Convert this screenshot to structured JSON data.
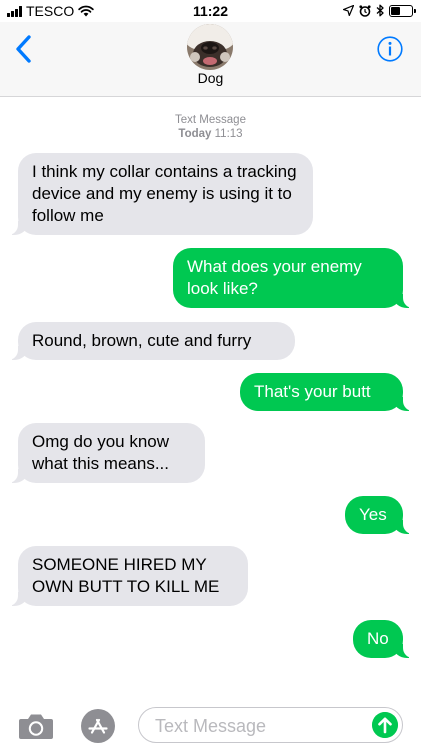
{
  "status_bar": {
    "carrier": "TESCO",
    "time": "11:22",
    "icons": [
      "signal-icon",
      "wifi-icon",
      "location-arrow-icon",
      "alarm-icon",
      "bluetooth-icon",
      "battery-icon"
    ],
    "battery_level": 0.4
  },
  "header": {
    "contact_name": "Dog",
    "back_icon": "chevron-left-icon",
    "info_icon": "info-icon",
    "accent_color": "#007aff"
  },
  "thread": {
    "service": "Text Message",
    "timestamp_prefix": "Today",
    "timestamp_time": "11:13",
    "messages": [
      {
        "from": "them",
        "text": "I think my collar contains a tracking device and my enemy is using it to follow me"
      },
      {
        "from": "me",
        "text": "What does your enemy look like?"
      },
      {
        "from": "them",
        "text": "Round, brown, cute and furry"
      },
      {
        "from": "me",
        "text": "That's your butt"
      },
      {
        "from": "them",
        "text": "Omg do you know what this means..."
      },
      {
        "from": "me",
        "text": "Yes"
      },
      {
        "from": "them",
        "text": "SOMEONE HIRED MY OWN BUTT TO KILL ME"
      },
      {
        "from": "me",
        "text": "No"
      }
    ],
    "incoming_color": "#e5e5ea",
    "outgoing_color": "#00c851"
  },
  "input_bar": {
    "placeholder": "Text Message",
    "value": "",
    "camera_icon": "camera-icon",
    "apps_icon": "app-store-icon",
    "send_icon": "send-arrow-icon"
  }
}
